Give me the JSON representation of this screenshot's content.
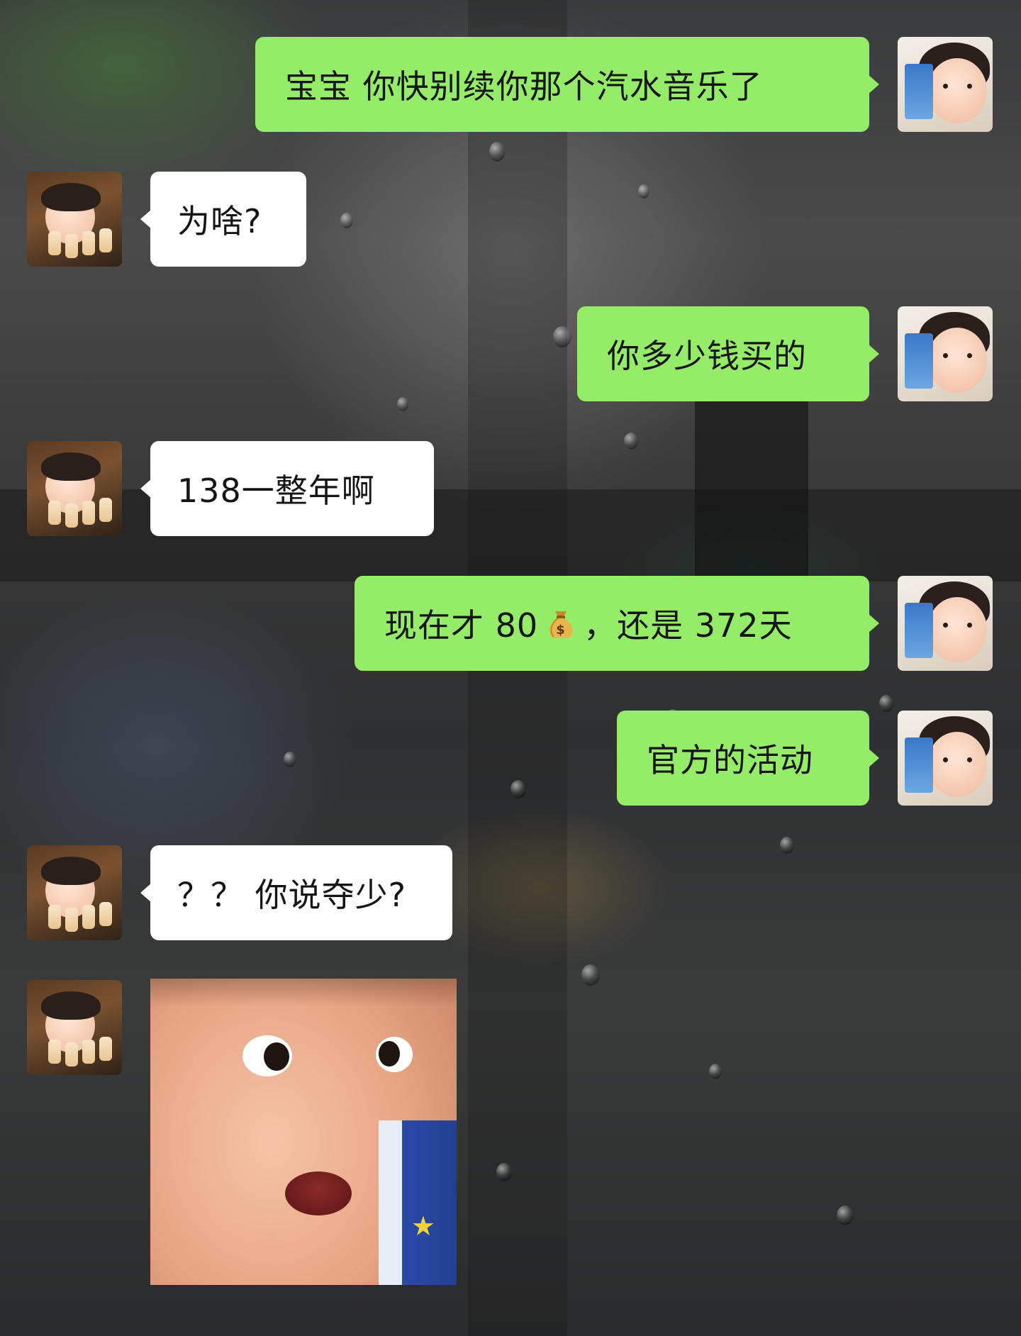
{
  "messages": [
    {
      "id": "m1",
      "side": "me",
      "text": "宝宝 你快别续你那个汽水音乐了"
    },
    {
      "id": "m2",
      "side": "them",
      "text": "为啥?"
    },
    {
      "id": "m3",
      "side": "me",
      "text": "你多少钱买的"
    },
    {
      "id": "m4",
      "side": "them",
      "text": "138一整年啊"
    },
    {
      "id": "m5",
      "side": "me",
      "text_before": "现在才 80",
      "emoji": "money-bag-icon",
      "text_after": "，还是 372天"
    },
    {
      "id": "m6",
      "side": "me",
      "text": "官方的活动"
    },
    {
      "id": "m7",
      "side": "them",
      "text": "？？ 你说夺少?"
    },
    {
      "id": "m8",
      "side": "them",
      "type": "sticker",
      "sticker": "surprised-baby-sticker"
    }
  ],
  "colors": {
    "my_bubble": "#95ec69",
    "their_bubble": "#ffffff",
    "text": "#151515"
  }
}
